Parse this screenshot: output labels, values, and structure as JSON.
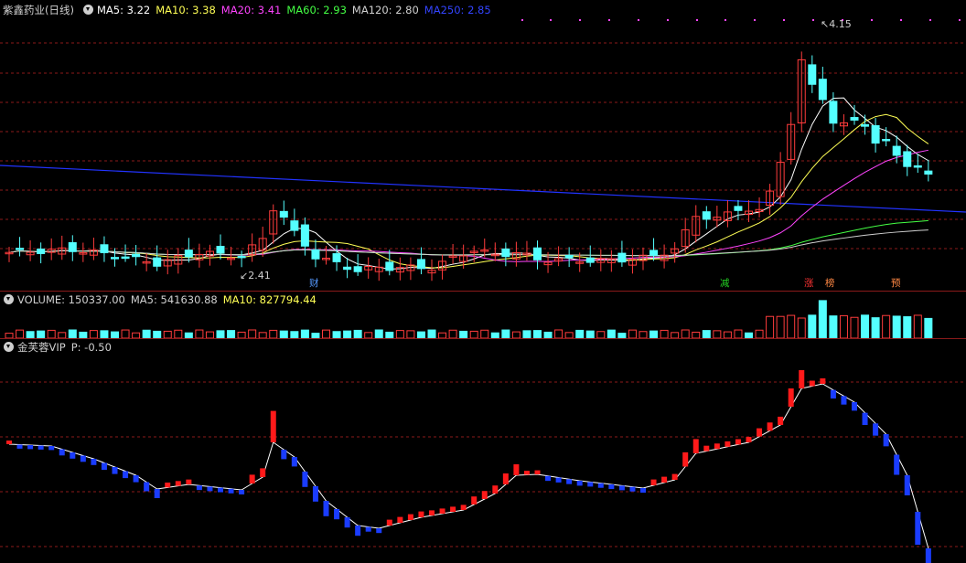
{
  "main_panel": {
    "title": "紫鑫药业(日线)",
    "indicators": [
      {
        "label": "MA5: 3.22",
        "color": "#ffffff"
      },
      {
        "label": "MA10: 3.38",
        "color": "#ffff55"
      },
      {
        "label": "MA20: 3.41",
        "color": "#ff44ff"
      },
      {
        "label": "MA60: 2.93",
        "color": "#44ff44"
      },
      {
        "label": "MA120: 2.80",
        "color": "#d0d0d0"
      },
      {
        "label": "MA250: 2.85",
        "color": "#3344ff"
      }
    ],
    "high_label": "4.15",
    "low_label": "2.41",
    "event_tags": [
      {
        "text": "财",
        "color": "#5599ff"
      },
      {
        "text": "减",
        "color": "#22cc22"
      },
      {
        "text": "涨",
        "color": "#ff3333"
      },
      {
        "text": "榜",
        "color": "#ff8844"
      },
      {
        "text": "预",
        "color": "#ff8844"
      }
    ]
  },
  "volume_panel": {
    "indicators": [
      {
        "label": "VOLUME: 150337.00",
        "color": "#d0d0d0"
      },
      {
        "label": "MA5: 541630.88",
        "color": "#d0d0d0"
      },
      {
        "label": "MA10: 827794.44",
        "color": "#ffff55"
      }
    ]
  },
  "indicator_panel": {
    "indicators": [
      {
        "label": "金芙蓉VIP",
        "color": "#d0d0d0"
      },
      {
        "label": "P: -0.50",
        "color": "#d0d0d0"
      }
    ]
  },
  "colors": {
    "up": "#ff3c3c",
    "down": "#54ffff",
    "grid": "#8b1a1a"
  }
}
